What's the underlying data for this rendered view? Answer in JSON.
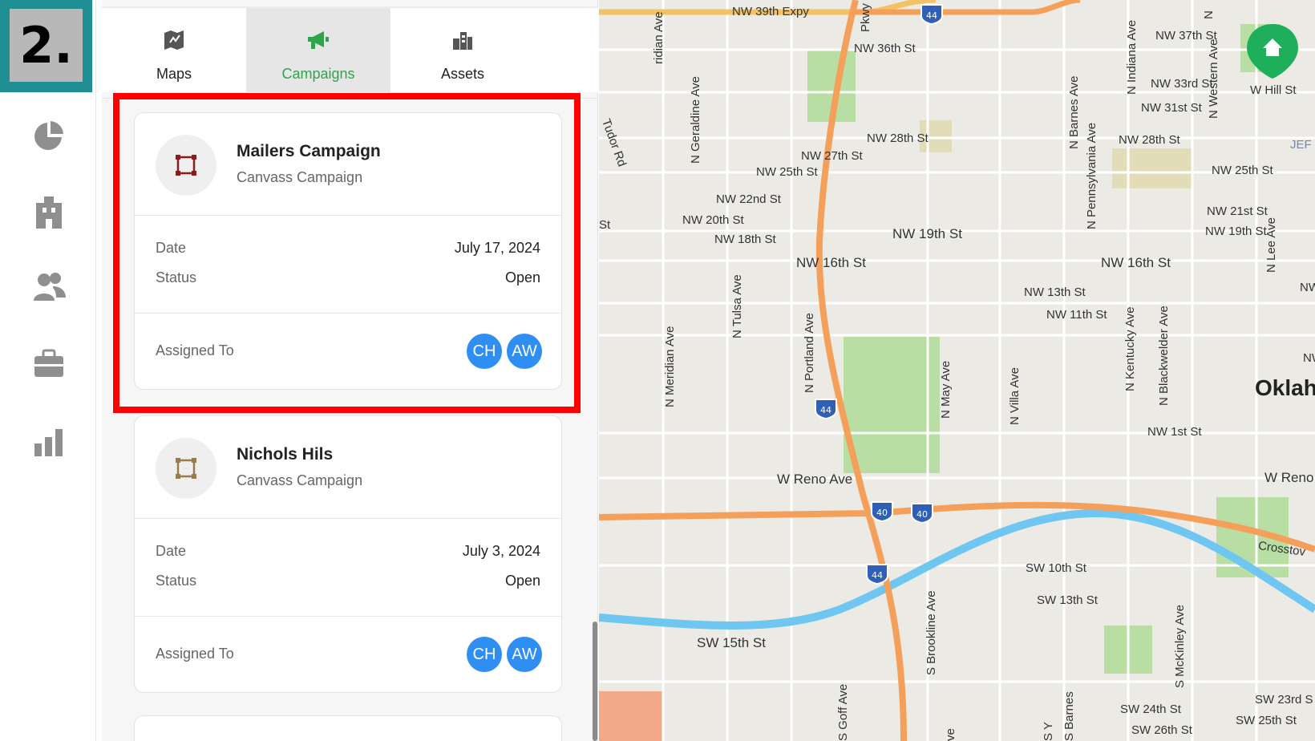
{
  "step_badge": "2.",
  "tabs": [
    {
      "label": "Maps"
    },
    {
      "label": "Campaigns"
    },
    {
      "label": "Assets"
    }
  ],
  "campaigns": [
    {
      "title": "Mailers Campaign",
      "subtitle": "Canvass Campaign",
      "date_label": "Date",
      "date": "July 17, 2024",
      "status_label": "Status",
      "status": "Open",
      "assigned_label": "Assigned To",
      "assignees": [
        "CH",
        "AW"
      ]
    },
    {
      "title": "Nichols Hils",
      "subtitle": "Canvass Campaign",
      "date_label": "Date",
      "date": "July 3, 2024",
      "status_label": "Status",
      "status": "Open",
      "assigned_label": "Assigned To",
      "assignees": [
        "CH",
        "AW"
      ]
    }
  ],
  "map": {
    "labels": {
      "nw39": "NW 39th Expy",
      "nw36": "NW 36th St",
      "nw37": "NW 37th St",
      "nw33": "NW 33rd St",
      "whill": "W Hill St",
      "nw31": "NW 31st St",
      "nw28a": "NW 28th St",
      "nw28b": "NW 28th St",
      "nw27": "NW 27th St",
      "nw25a": "NW 25th St",
      "nw25b": "NW 25th St",
      "nw22": "NW 22nd St",
      "nw21": "NW 21st St",
      "nw20": "NW 20th St",
      "nw19a": "NW 19th St",
      "nw19b": "NW 19th St",
      "nw18": "NW 18th St",
      "nw16a": "NW 16th St",
      "nw16b": "NW 16th St",
      "nw13": "NW 13th St",
      "nw11": "NW 11th St",
      "nw1": "NW 1st St",
      "wreno": "W Reno Ave",
      "wreno2": "W Reno",
      "okla": "Oklah",
      "sw10": "SW 10th St",
      "sw13": "SW 13th St",
      "sw15": "SW 15th St",
      "sw24": "SW 24th St",
      "sw25": "SW 25th St",
      "sw26": "SW 26th St",
      "sw23": "SW 23rd S",
      "cross": "Crosstov",
      "jef": "JEF",
      "pkwy": "Pkwy",
      "ridian": "ridian Ave",
      "tudor": "Tudor Rd",
      "geraldine": "N Geraldine Ave",
      "indiana": "N Indiana Ave",
      "western": "N Western Ave",
      "barnes": "N Barnes Ave",
      "penn": "N Pennsylvania Ave",
      "lee": "N Lee Ave",
      "tulsa": "N Tulsa Ave",
      "portland": "N Portland Ave",
      "meridian": "N Meridian Ave",
      "may": "N May Ave",
      "villa": "N Villa Ave",
      "kentucky": "N Kentucky Ave",
      "blackwelder": "N Blackwelder Ave",
      "brookline": "S Brookline Ave",
      "goff": "S Goff Ave",
      "sbarnes": "S Barnes",
      "mckinley": "S McKinley Ave",
      "nwe": "NW",
      "nwe2": "NW",
      "st": "St",
      "ve": "ve",
      "sy": "S Y",
      "nn": "N"
    },
    "shields": {
      "i44": "44",
      "i40": "40"
    }
  }
}
